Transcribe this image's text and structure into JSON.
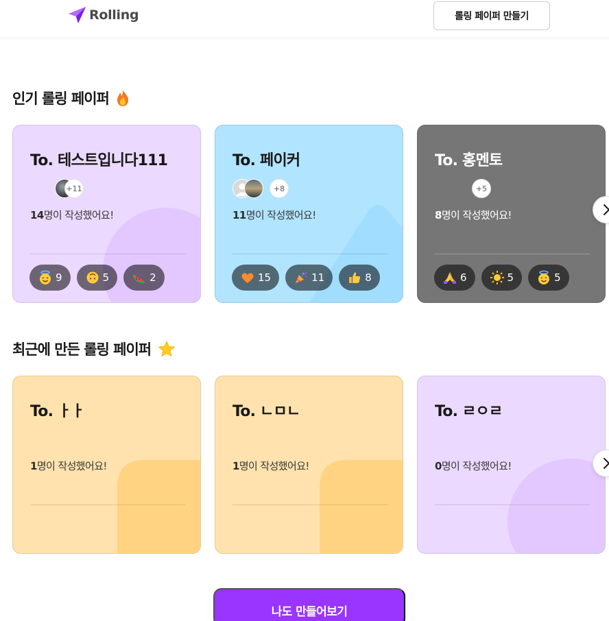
{
  "header": {
    "logo_text": "Rolling",
    "logo_icon": "paper-plane-icon",
    "create_button": "롤링 페이퍼 만들기"
  },
  "popular": {
    "title": "인기 롤링 페이퍼",
    "title_icon": "fire-icon",
    "cards": [
      {
        "to": "To. 테스트입니다111",
        "theme": "purple",
        "avatar_more": "+11",
        "count_num": "14",
        "count_suffix": "명이 작성했어요!",
        "reactions": [
          {
            "icon": "halo-smile-emoji",
            "count": "9"
          },
          {
            "icon": "upside-down-face-emoji",
            "count": "5"
          },
          {
            "icon": "watermelon-emoji",
            "count": "2"
          }
        ]
      },
      {
        "to": "To. 페이커",
        "theme": "blue",
        "avatar_more": "+8",
        "count_num": "11",
        "count_suffix": "명이 작성했어요!",
        "reactions": [
          {
            "icon": "orange-heart-emoji",
            "count": "15"
          },
          {
            "icon": "party-popper-emoji",
            "count": "11"
          },
          {
            "icon": "thumbs-up-emoji",
            "count": "8"
          }
        ]
      },
      {
        "to": "To. 홍멘토",
        "theme": "gray",
        "avatar_more": "+5",
        "count_num": "8",
        "count_suffix": "명이 작성했어요!",
        "reactions": [
          {
            "icon": "folded-hands-emoji",
            "count": "6"
          },
          {
            "icon": "sun-emoji",
            "count": "5"
          },
          {
            "icon": "halo-smile-emoji",
            "count": "5"
          }
        ]
      }
    ]
  },
  "recent": {
    "title": "최근에 만든 롤링 페이퍼",
    "title_icon": "star-icon",
    "cards": [
      {
        "to": "To. ㅏㅏ",
        "theme": "beige",
        "count_num": "1",
        "count_suffix": "명이 작성했어요!"
      },
      {
        "to": "To. ㄴㅁㄴ",
        "theme": "beige",
        "count_num": "1",
        "count_suffix": "명이 작성했어요!"
      },
      {
        "to": "To. ㄹㅇㄹ",
        "theme": "purple",
        "count_num": "0",
        "count_suffix": "명이 작성했어요!"
      }
    ]
  },
  "cta": {
    "label": "나도 만들어보기"
  },
  "colors": {
    "brand": "#9935ff",
    "purple_card": "#ecd9ff",
    "blue_card": "#b1e4ff",
    "gray_card": "#767676",
    "beige_card": "#ffe2ad"
  }
}
